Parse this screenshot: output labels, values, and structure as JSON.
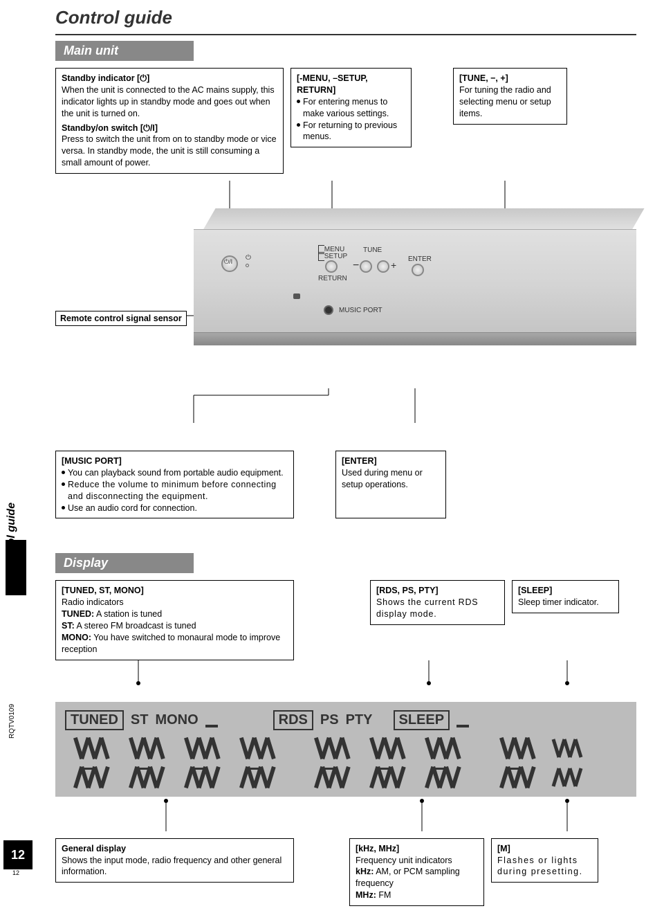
{
  "page": {
    "title": "Control guide",
    "main_unit": "Main unit",
    "display": "Display",
    "sidebar": "Control guide",
    "ref": "RQTV0109",
    "num": "12",
    "tiny": "12"
  },
  "callouts": {
    "standby": {
      "h1": "Standby indicator [⏻]",
      "p1": "When the unit is connected to the AC mains supply, this indicator lights up in standby mode and goes out when the unit is turned on.",
      "h2": "Standby/on switch [⏻/I]",
      "p2": "Press to switch the unit from on to standby mode or vice versa. In standby mode, the unit is still consuming a small amount of power."
    },
    "menu": {
      "h": "[-MENU, –SETUP, RETURN]",
      "b1": "For entering menus to make various settings.",
      "b2": "For returning to previous menus."
    },
    "tune": {
      "h": "[TUNE, −, +]",
      "p": "For tuning the radio and selecting menu or setup items."
    },
    "music": {
      "h": "[MUSIC PORT]",
      "b1": "You can playback sound from portable audio equipment.",
      "b2": "Reduce the volume to minimum before connecting and disconnecting the equipment.",
      "b3": "Use an audio cord for connection."
    },
    "enter": {
      "h": "[ENTER]",
      "p": "Used during menu or setup operations."
    },
    "tuned": {
      "h": "[TUNED, ST, MONO]",
      "s": "Radio indicators",
      "l1a": "TUNED:",
      "l1b": " A station is tuned",
      "l2a": "ST:",
      "l2b": " A stereo FM broadcast is tuned",
      "l3a": "MONO:",
      "l3b": " You have switched to monaural mode to improve reception"
    },
    "rds": {
      "h": "[RDS, PS, PTY]",
      "p": "Shows the current RDS display mode."
    },
    "sleep": {
      "h": "[SLEEP]",
      "p": "Sleep timer indicator."
    },
    "general": {
      "h": "General display",
      "p": "Shows the input mode, radio frequency and other general information."
    },
    "khz": {
      "h": "[kHz, MHz]",
      "p1": "Frequency unit indicators",
      "l1a": "kHz:",
      "l1b": " AM, or PCM sampling frequency",
      "l2a": "MHz:",
      "l2b": " FM"
    },
    "m": {
      "h": "[M]",
      "p": "Flashes or lights during presetting."
    }
  },
  "device": {
    "sensor": "Remote control signal sensor",
    "labels": {
      "menu": "MENU",
      "setup": "SETUP",
      "return": "RETURN",
      "tune": "TUNE",
      "minus": "−",
      "plus": "+",
      "enter": "ENTER",
      "music_port": "MUSIC PORT",
      "power": "⏻/I",
      "pwr_icon": "⏻"
    }
  },
  "lcd": {
    "tuned": "TUNED",
    "st": "ST",
    "mono": "MONO",
    "rds": "RDS",
    "ps": "PS",
    "pty": "PTY",
    "sleep": "SLEEP"
  }
}
